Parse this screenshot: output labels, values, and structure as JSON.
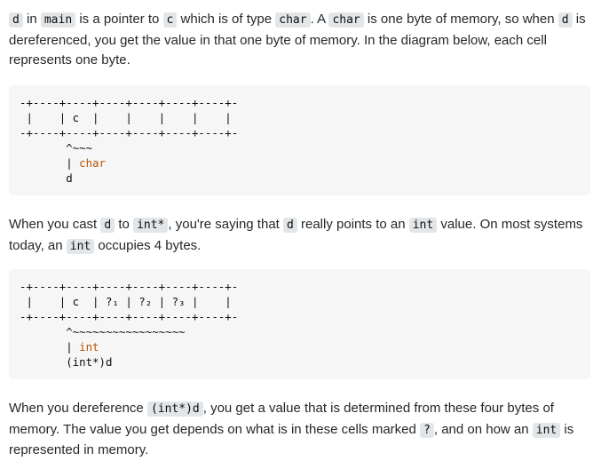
{
  "para1": {
    "t1": "d",
    "t2": " in ",
    "t3": "main",
    "t4": " is a pointer to ",
    "t5": "c",
    "t6": " which is of type ",
    "t7": "char",
    "t8": ". A ",
    "t9": "char",
    "t10": " is one byte of memory, so when ",
    "t11": "d",
    "t12": " is dereferenced, you get the value in that one byte of memory. In the diagram below, each cell represents one byte."
  },
  "diagram1": {
    "border_top": "-+----+----+----+----+----+----+-",
    "cells_row": " |    | c  |    |    |    |    |",
    "border_bottom": "-+----+----+----+----+----+----+-",
    "pointer_marks": "       ^~~~",
    "type_line_prefix": "       | ",
    "type_word": "char",
    "var_line": "       d"
  },
  "para2": {
    "t1": "When you cast ",
    "t2": "d",
    "t3": " to ",
    "t4": "int*",
    "t5": ", you're saying that ",
    "t6": "d",
    "t7": " really points to an ",
    "t8": "int",
    "t9": " value. On most systems today, an ",
    "t10": "int",
    "t11": " occupies 4 bytes."
  },
  "diagram2": {
    "border_top": "-+----+----+----+----+----+----+-",
    "cells_row": " |    | c  | ?₁ | ?₂ | ?₃ |    |",
    "border_bottom": "-+----+----+----+----+----+----+-",
    "pointer_marks": "       ^~~~~~~~~~~~~~~~~~",
    "type_line_prefix": "       | ",
    "type_word": "int",
    "var_line": "       (int*)d"
  },
  "para3": {
    "t1": "When you dereference ",
    "t2": "(int*)d",
    "t3": ", you get a value that is determined from these four bytes of memory. The value you get depends on what is in these cells marked ",
    "t4": "?",
    "t5": ", and on how an ",
    "t6": "int",
    "t7": " is represented in memory."
  }
}
